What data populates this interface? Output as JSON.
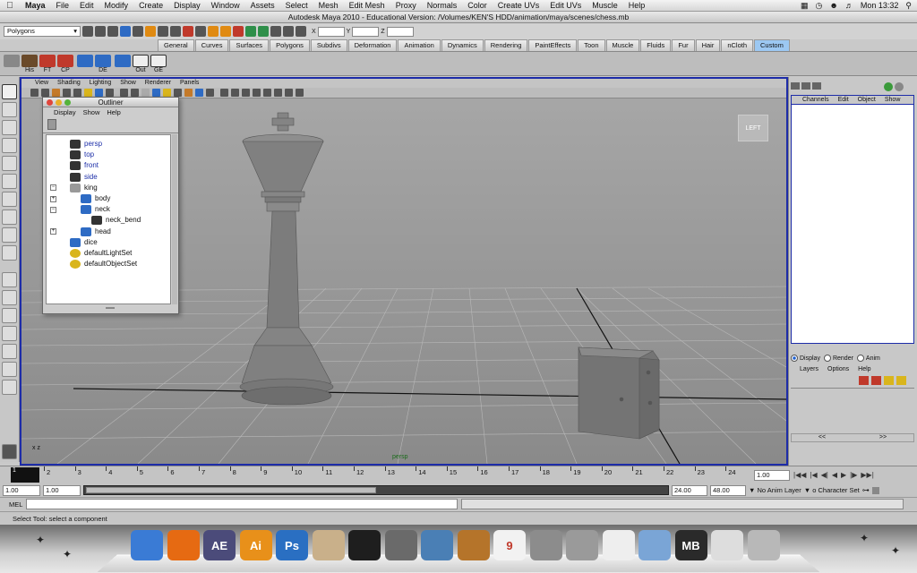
{
  "menubar": {
    "app": "Maya",
    "items": [
      "File",
      "Edit",
      "Modify",
      "Create",
      "Display",
      "Window",
      "Assets",
      "Select",
      "Mesh",
      "Edit Mesh",
      "Proxy",
      "Normals",
      "Color",
      "Create UVs",
      "Edit UVs",
      "Muscle",
      "Help"
    ],
    "clock": "Mon 13:32"
  },
  "window": {
    "title": "Autodesk Maya 2010 - Educational Version: /Volumes/KEN'S HDD/animation/maya/scenes/chess.mb"
  },
  "statusline": {
    "menuset": "Polygons",
    "x_label": "X",
    "y_label": "Y",
    "z_label": "Z"
  },
  "shelf": {
    "tabs": [
      "General",
      "Curves",
      "Surfaces",
      "Polygons",
      "Subdivs",
      "Deformation",
      "Animation",
      "Dynamics",
      "Rendering",
      "PaintEffects",
      "Toon",
      "Muscle",
      "Fluids",
      "Fur",
      "Hair",
      "nCloth",
      "Custom"
    ],
    "active_tab": "Custom",
    "buttons": [
      "His",
      "FT",
      "CP",
      "DE",
      "Out",
      "GE"
    ]
  },
  "viewport": {
    "menu": [
      "View",
      "Shading",
      "Lighting",
      "Show",
      "Renderer",
      "Panels"
    ],
    "viewcube_label": "LEFT",
    "camera_label": "persp",
    "axis_label": "x z"
  },
  "outliner": {
    "title": "Outliner",
    "menu": [
      "Display",
      "Show",
      "Help"
    ],
    "items": [
      {
        "label": "persp",
        "type": "camera",
        "indent": 0,
        "expand": ""
      },
      {
        "label": "top",
        "type": "camera",
        "indent": 0,
        "expand": ""
      },
      {
        "label": "front",
        "type": "camera",
        "indent": 0,
        "expand": ""
      },
      {
        "label": "side",
        "type": "camera",
        "indent": 0,
        "expand": ""
      },
      {
        "label": "king",
        "type": "transform",
        "indent": 0,
        "expand": "−"
      },
      {
        "label": "body",
        "type": "mesh",
        "indent": 1,
        "expand": "+"
      },
      {
        "label": "neck",
        "type": "mesh",
        "indent": 1,
        "expand": "−"
      },
      {
        "label": "neck_bend",
        "type": "deformer",
        "indent": 2,
        "expand": ""
      },
      {
        "label": "head",
        "type": "mesh",
        "indent": 1,
        "expand": "+"
      },
      {
        "label": "dice",
        "type": "mesh",
        "indent": 0,
        "expand": ""
      },
      {
        "label": "defaultLightSet",
        "type": "set",
        "indent": 0,
        "expand": ""
      },
      {
        "label": "defaultObjectSet",
        "type": "set",
        "indent": 0,
        "expand": ""
      }
    ]
  },
  "channelbox": {
    "menu": [
      "Channels",
      "Edit",
      "Object",
      "Show"
    ],
    "layer_modes": [
      "Display",
      "Render",
      "Anim"
    ],
    "active_layer_mode": "Display",
    "layer_menu": [
      "Layers",
      "Options",
      "Help"
    ],
    "scroll_left": "<<",
    "scroll_right": ">>"
  },
  "timeline": {
    "ticks": [
      "2",
      "3",
      "4",
      "5",
      "6",
      "7",
      "8",
      "9",
      "10",
      "11",
      "12",
      "13",
      "14",
      "15",
      "16",
      "17",
      "18",
      "19",
      "20",
      "21",
      "22",
      "23",
      "24"
    ],
    "current_frame": "1",
    "current_field": "1.00"
  },
  "range": {
    "start": "1.00",
    "start_inner": "1.00",
    "end_inner": "24.00",
    "end": "48.00",
    "anim_layer": "No Anim Layer",
    "char_set": "o Character Set"
  },
  "cmdline": {
    "label": "MEL"
  },
  "helpline": {
    "text": "Select Tool: select a component"
  },
  "dock": {
    "apps": [
      {
        "name": "finder-icon",
        "label": "",
        "color": "#3a7bd5"
      },
      {
        "name": "firefox-icon",
        "label": "",
        "color": "#e66a12"
      },
      {
        "name": "after-effects-icon",
        "label": "AE",
        "color": "#4b4b7a"
      },
      {
        "name": "illustrator-icon",
        "label": "Ai",
        "color": "#e8901a"
      },
      {
        "name": "photoshop-icon",
        "label": "Ps",
        "color": "#2a6fc2"
      },
      {
        "name": "pencil-icon",
        "label": "",
        "color": "#c9b08a"
      },
      {
        "name": "maya-icon",
        "label": "",
        "color": "#1e1e1e"
      },
      {
        "name": "camera-icon",
        "label": "",
        "color": "#6a6a6a"
      },
      {
        "name": "iphoto-icon",
        "label": "",
        "color": "#4a7fb5"
      },
      {
        "name": "garageband-icon",
        "label": "",
        "color": "#b5742a"
      },
      {
        "name": "calendar-icon",
        "label": "9",
        "color": "#f2f2f2"
      },
      {
        "name": "preferences-icon",
        "label": "",
        "color": "#8c8c8c"
      },
      {
        "name": "print-icon",
        "label": "",
        "color": "#9a9a9a"
      },
      {
        "name": "textedit-icon",
        "label": "",
        "color": "#eeeeee"
      },
      {
        "name": "folder-icon",
        "label": "",
        "color": "#7aa5d6"
      },
      {
        "name": "mb-file-icon",
        "label": "MB",
        "color": "#2a2a2a"
      },
      {
        "name": "screenshot-icon",
        "label": "",
        "color": "#ddd"
      },
      {
        "name": "trash-icon",
        "label": "",
        "color": "#b8b8b8"
      }
    ]
  }
}
